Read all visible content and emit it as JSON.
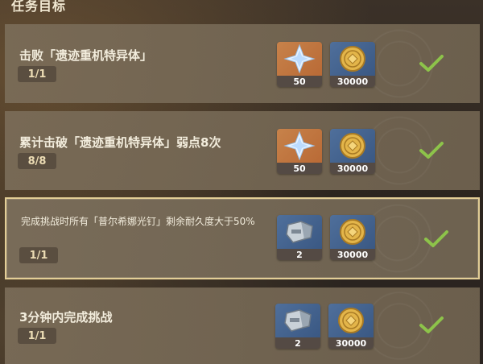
{
  "header": {
    "title": "任务目标"
  },
  "tasks": [
    {
      "title": "击败「遗迹重机特异体」",
      "progress": "1/1",
      "rewards": [
        {
          "icon": "primogem-icon",
          "count": "50"
        },
        {
          "icon": "mora-icon",
          "count": "30000"
        }
      ],
      "completed": true
    },
    {
      "title": "累计击破「遗迹重机特异体」弱点8次",
      "progress": "8/8",
      "rewards": [
        {
          "icon": "primogem-icon",
          "count": "50"
        },
        {
          "icon": "mora-icon",
          "count": "30000"
        }
      ],
      "completed": true
    },
    {
      "title": "完成挑战时所有「普尔希娜光钉」剩余耐久度大于50%",
      "progress": "1/1",
      "rewards": [
        {
          "icon": "gauntlet-icon",
          "count": "2"
        },
        {
          "icon": "mora-icon",
          "count": "30000"
        }
      ],
      "completed": true
    },
    {
      "title": "3分钟内完成挑战",
      "progress": "1/1",
      "rewards": [
        {
          "icon": "gauntlet-icon",
          "count": "2"
        },
        {
          "icon": "mora-icon",
          "count": "30000"
        }
      ],
      "completed": true
    }
  ],
  "colors": {
    "check": "#8dc34a",
    "card_border_highlight": "#e3ce96",
    "progress_bg": "#5a4e40"
  }
}
